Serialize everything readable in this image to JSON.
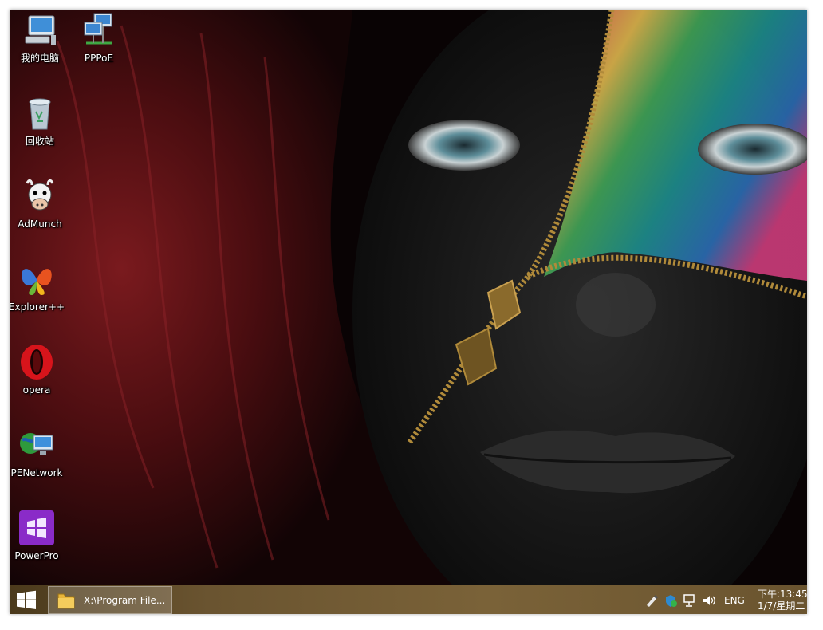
{
  "desktop": {
    "icons": [
      {
        "label": "我的电脑",
        "icon": "computer-icon"
      },
      {
        "label": "PPPoE",
        "icon": "network-connection-icon"
      },
      {
        "label": "回收站",
        "icon": "recycle-bin-icon"
      },
      {
        "label": "AdMunch",
        "icon": "cow-icon"
      },
      {
        "label": "Explorer++",
        "icon": "explorer-butterfly-icon"
      },
      {
        "label": "opera",
        "icon": "opera-icon"
      },
      {
        "label": "PENetwork",
        "icon": "globe-monitor-icon"
      },
      {
        "label": "PowerPro",
        "icon": "powerpro-icon"
      }
    ],
    "wallpaper": "painted-face-zipper-wallpaper"
  },
  "taskbar": {
    "start_icon": "windows-logo-icon",
    "task_item_label": "X:\\Program File...",
    "task_item_icon": "folder-icon",
    "tray_icons": [
      "pen-tool-icon",
      "shield-icon",
      "network-icon",
      "volume-icon"
    ],
    "language": "ENG",
    "time": "下午:13:45",
    "date": "1/7/星期二"
  },
  "colors": {
    "taskbar": "#6a5430",
    "icon_label": "#ffffff"
  }
}
